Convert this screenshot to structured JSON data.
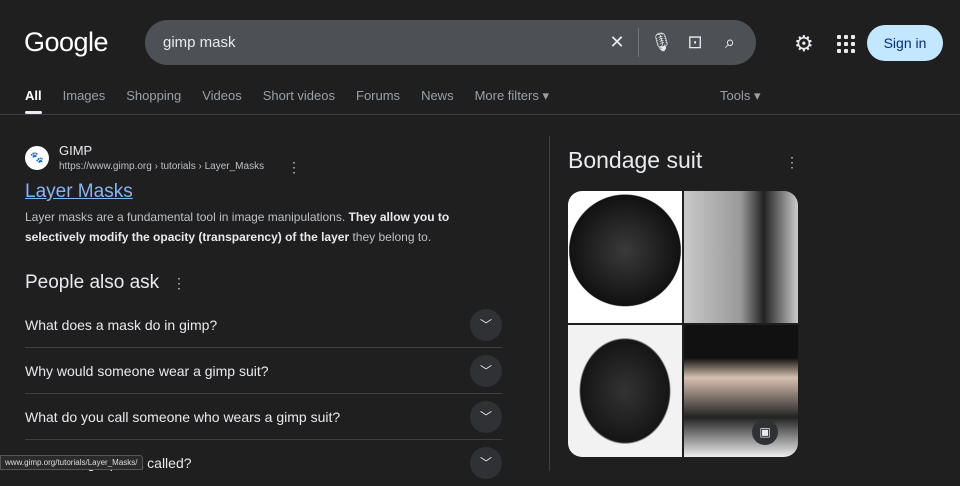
{
  "logo": "Google",
  "search": {
    "value": "gimp mask"
  },
  "header": {
    "sign_in": "Sign in"
  },
  "tabs": [
    "All",
    "Images",
    "Shopping",
    "Videos",
    "Short videos",
    "Forums",
    "News",
    "More filters ▾"
  ],
  "tools": "Tools ▾",
  "result": {
    "site": "GIMP",
    "url": "https://www.gimp.org › tutorials › Layer_Masks",
    "title": "Layer Masks",
    "snippet_a": "Layer masks are a fundamental tool in image manipulations. ",
    "snippet_b": "They allow you to selectively modify the opacity (transparency) of the layer",
    "snippet_c": " they belong to."
  },
  "paa": {
    "title": "People also ask",
    "questions": [
      "What does a mask do in gimp?",
      "Why would someone wear a gimp suit?",
      "What do you call someone who wears a gimp suit?",
      "What is a gimp suit called?"
    ]
  },
  "knowledge_panel": {
    "title": "Bondage suit"
  },
  "status_url": "www.gimp.org/tutorials/Layer_Masks/"
}
